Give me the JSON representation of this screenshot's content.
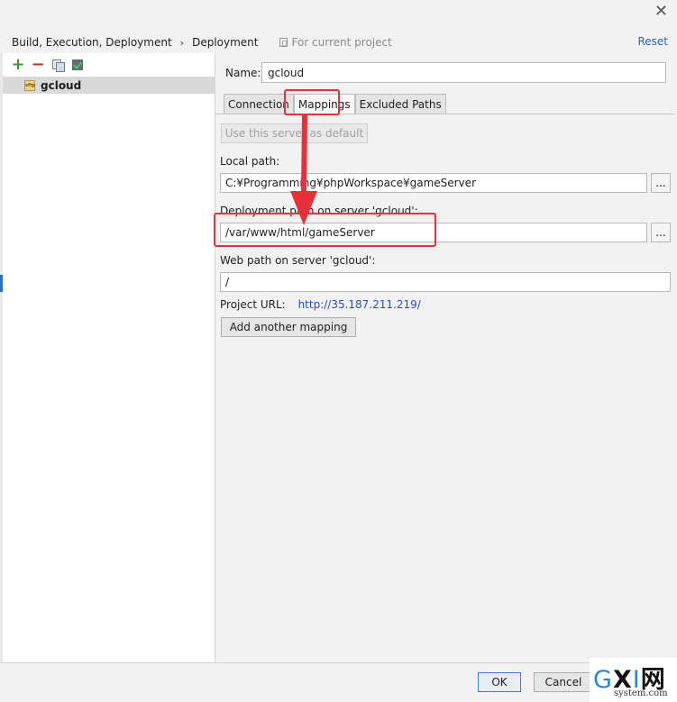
{
  "window": {
    "close_glyph": "✕"
  },
  "breadcrumb": {
    "parent": "Build, Execution, Deployment",
    "separator": "›",
    "current": "Deployment",
    "scope": "For current project",
    "reset": "Reset"
  },
  "left_panel": {
    "toolbar": {
      "add": "+",
      "remove": "−",
      "copy_icon": "copy-icon",
      "check_icon": "check-default-icon"
    },
    "servers": [
      {
        "label": "gcloud",
        "icon": "sftp-server-icon",
        "icon_text": "sftp",
        "selected": true
      }
    ]
  },
  "server": {
    "name_label": "Name:",
    "name_value": "gcloud"
  },
  "tabs": [
    {
      "label": "Connection",
      "active": false
    },
    {
      "label": "Mappings",
      "active": true
    },
    {
      "label": "Excluded Paths",
      "active": false
    }
  ],
  "mappings": {
    "use_default_button": "Use this server as default",
    "local_path_label": "Local path:",
    "local_path_value": "C:¥Programming¥phpWorkspace¥gameServer",
    "deployment_path_label": "Deployment path on server 'gcloud':",
    "deployment_path_value": "/var/www/html/gameServer",
    "web_path_label": "Web path on server 'gcloud':",
    "web_path_value": "/",
    "browse_label": "...",
    "project_url_label": "Project URL:",
    "project_url_value": "http://35.187.211.219/",
    "add_mapping_button": "Add another mapping"
  },
  "footer": {
    "ok": "OK",
    "cancel": "Cancel"
  },
  "annotation_color": "#e8303a",
  "watermark": {
    "logo_g": "G",
    "logo_x": "X",
    "logo_i": "I",
    "logo_net": "网",
    "domain": "system.com"
  }
}
